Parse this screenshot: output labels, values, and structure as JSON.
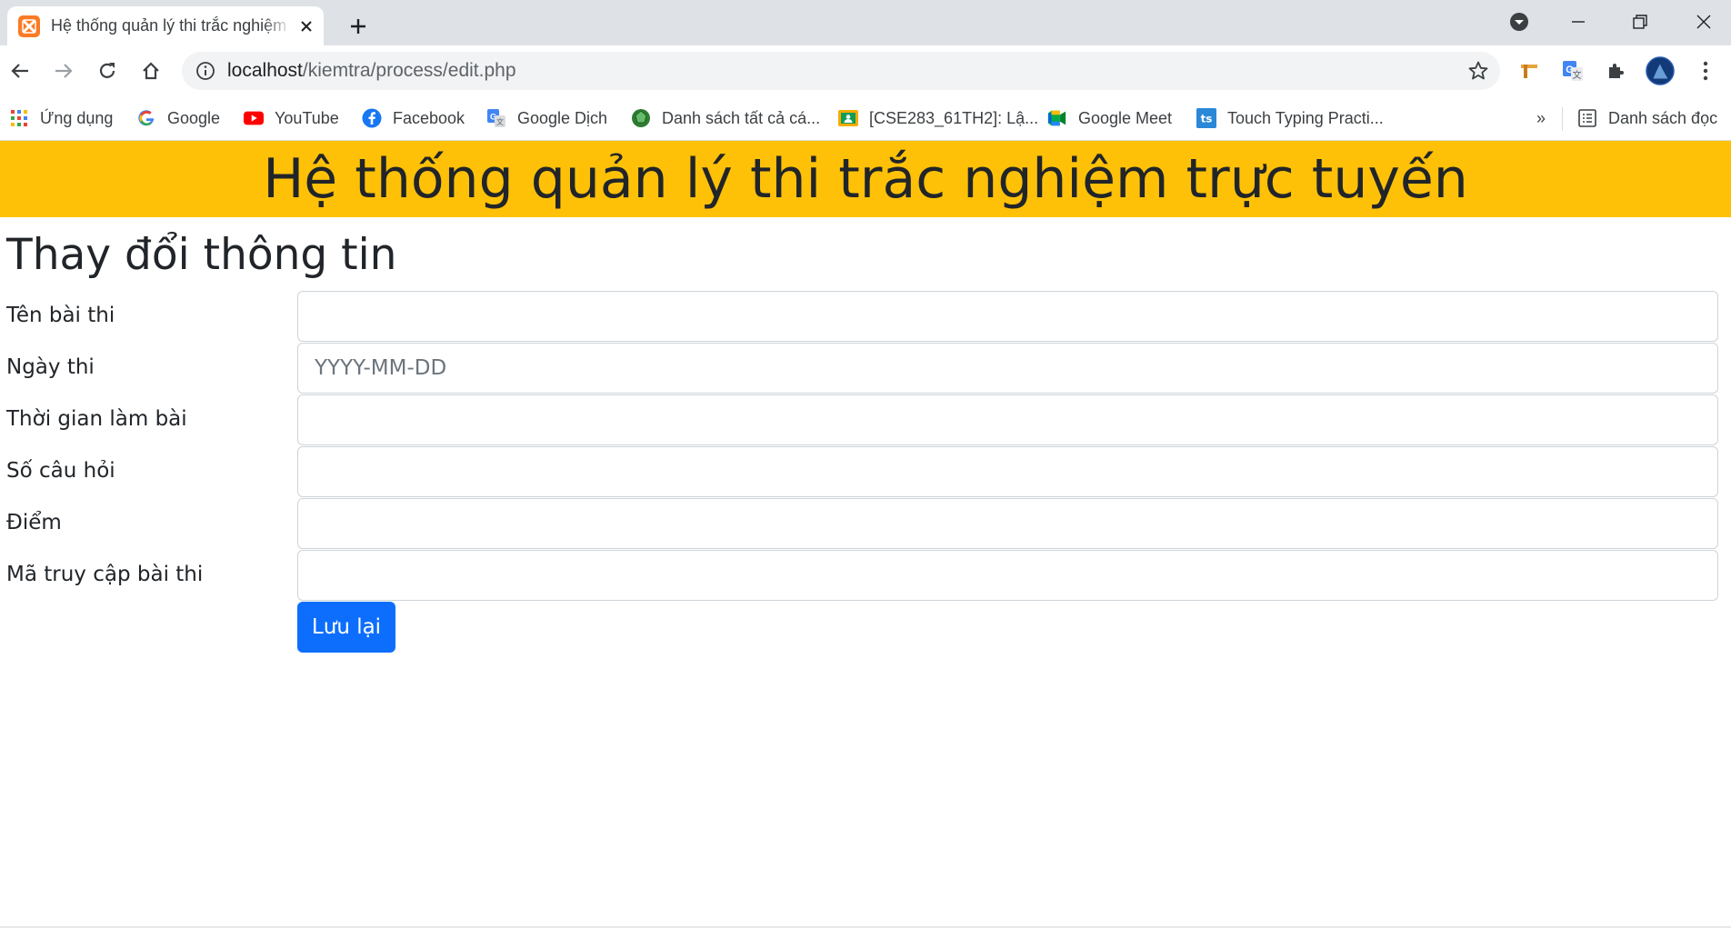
{
  "browser": {
    "tab_title": "Hệ thống quản lý thi trắc nghiệm trực tuyến",
    "url_host": "localhost",
    "url_path": "/kiemtra/process/edit.php",
    "icons": [
      "close-icon",
      "plus-icon",
      "back-arrow-icon",
      "forward-arrow-icon",
      "reload-icon",
      "home-icon",
      "info-icon",
      "star-icon",
      "puzzle-icon",
      "kebab-menu-icon"
    ],
    "bookmarks": [
      {
        "label": "Ứng dụng",
        "icon": "apps-grid-icon"
      },
      {
        "label": "Google",
        "icon": "google-icon"
      },
      {
        "label": "YouTube",
        "icon": "youtube-icon"
      },
      {
        "label": "Facebook",
        "icon": "facebook-icon"
      },
      {
        "label": "Google Dịch",
        "icon": "google-translate-icon"
      },
      {
        "label": "Danh sách tất cả cá...",
        "icon": "globe-icon"
      },
      {
        "label": "[CSE283_61TH2]: Lậ...",
        "icon": "classroom-icon"
      },
      {
        "label": "Google Meet",
        "icon": "meet-icon"
      },
      {
        "label": "Touch Typing Practi...",
        "icon": "ts-icon"
      }
    ],
    "overflow_label": "»",
    "reading_list_label": "Danh sách đọc"
  },
  "page": {
    "banner_title": "Hệ thống quản lý thi trắc nghiệm trực tuyến",
    "heading": "Thay đổi thông tin",
    "fields": [
      {
        "label": "Tên bài thi",
        "value": "",
        "placeholder": ""
      },
      {
        "label": "Ngày thi",
        "value": "",
        "placeholder": "YYYY-MM-DD"
      },
      {
        "label": "Thời gian làm bài",
        "value": "",
        "placeholder": ""
      },
      {
        "label": "Số câu hỏi",
        "value": "",
        "placeholder": ""
      },
      {
        "label": "Điểm",
        "value": "",
        "placeholder": ""
      },
      {
        "label": "Mã truy cập bài thi",
        "value": "",
        "placeholder": ""
      }
    ],
    "save_label": "Lưu lại"
  },
  "colors": {
    "banner": "#fec107",
    "primary_button": "#0d6efd"
  }
}
